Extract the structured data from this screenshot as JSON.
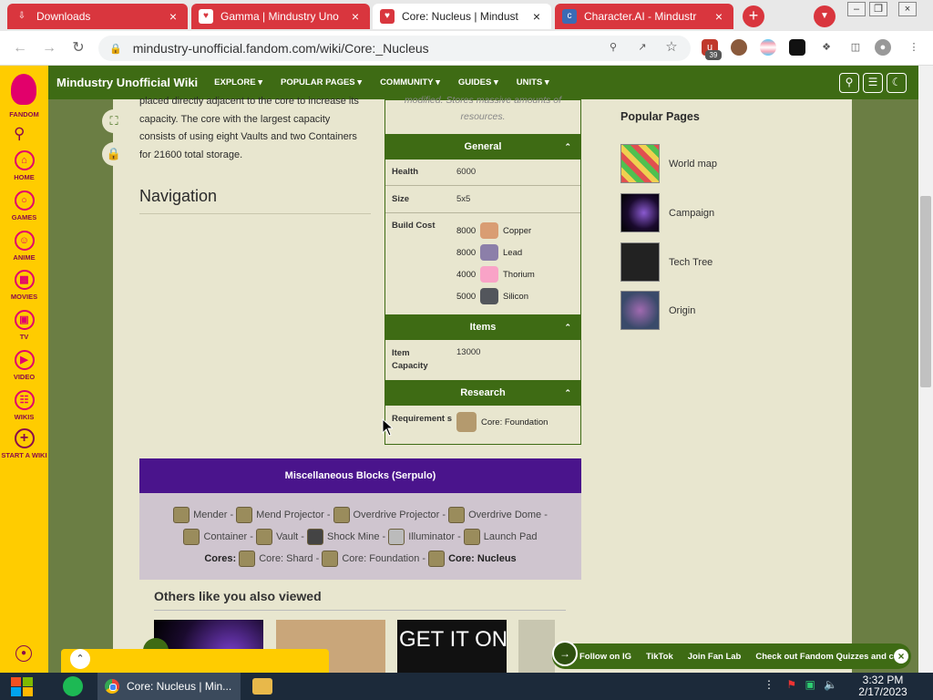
{
  "browser": {
    "tabs": [
      {
        "label": "Downloads",
        "icon": "download-icon",
        "active": false
      },
      {
        "label": "Gamma | Mindustry Uno",
        "icon": "fandom-icon",
        "active": false
      },
      {
        "label": "Core: Nucleus | Mindust",
        "icon": "fandom-icon",
        "active": true
      },
      {
        "label": "Character.AI - Mindustr",
        "icon": "character-ai-icon",
        "active": false
      }
    ],
    "new_tab_label": "+",
    "url": "mindustry-unofficial.fandom.com/wiki/Core:_Nucleus",
    "extension_badge": "39"
  },
  "rail": {
    "fandom": "FANDOM",
    "items": [
      {
        "label": "HOME",
        "icon": "home-icon"
      },
      {
        "label": "GAMES",
        "icon": "games-icon"
      },
      {
        "label": "ANIME",
        "icon": "anime-icon"
      },
      {
        "label": "MOVIES",
        "icon": "movies-icon"
      },
      {
        "label": "TV",
        "icon": "tv-icon"
      },
      {
        "label": "VIDEO",
        "icon": "video-icon"
      },
      {
        "label": "WIKIS",
        "icon": "wikis-icon"
      },
      {
        "label": "START A WIKI",
        "icon": "plus-icon"
      }
    ]
  },
  "wiki_nav": {
    "title": "Mindustry Unofficial Wiki",
    "links": [
      "EXPLORE",
      "POPULAR PAGES",
      "COMMUNITY",
      "GUIDES",
      "UNITS"
    ]
  },
  "article": {
    "intro": "placed directly adjacent to the core to increase its capacity. The core with the largest capacity consists of using eight Vaults and two Containers for 21600 total storage.",
    "navigation_heading": "Navigation"
  },
  "infobox": {
    "quote": "modified. Stores massive amounts of resources.",
    "sections": {
      "general": "General",
      "items": "Items",
      "research": "Research"
    },
    "health_label": "Health",
    "health_value": "6000",
    "size_label": "Size",
    "size_value": "5x5",
    "build_cost_label": "Build Cost",
    "build_cost": [
      {
        "amount": "8000",
        "item": "Copper",
        "color": "#d99d73"
      },
      {
        "amount": "8000",
        "item": "Lead",
        "color": "#8c7fa9"
      },
      {
        "amount": "4000",
        "item": "Thorium",
        "color": "#f9a3c7"
      },
      {
        "amount": "5000",
        "item": "Silicon",
        "color": "#53565c"
      }
    ],
    "item_capacity_label": "Item Capacity",
    "item_capacity_value": "13000",
    "requirement_label": "Requirement s",
    "requirement_value": "Core: Foundation"
  },
  "navbox": {
    "title": "Miscellaneous Blocks (Serpulo)",
    "line1": [
      "Mender",
      "Mend Projector",
      "Overdrive Projector",
      "Overdrive Dome"
    ],
    "line2": [
      "Container",
      "Vault",
      "Shock Mine",
      "Illuminator",
      "Launch Pad"
    ],
    "cores_label": "Cores:",
    "cores": [
      "Core: Shard",
      "Core: Foundation",
      "Core: Nucleus"
    ]
  },
  "others": {
    "heading": "Others like you also viewed",
    "thumb3_text": "GET IT ON"
  },
  "sidebar": {
    "popular_heading": "Popular Pages",
    "items": [
      {
        "label": "World map"
      },
      {
        "label": "Campaign"
      },
      {
        "label": "Tech Tree"
      },
      {
        "label": "Origin"
      }
    ]
  },
  "follow_bar": {
    "links": [
      "Follow on IG",
      "TikTok",
      "Join Fan Lab",
      "Check out Fandom Quizzes and cha"
    ]
  },
  "taskbar": {
    "chrome_window": "Core: Nucleus | Min...",
    "time": "3:32 PM",
    "date": "2/17/2023"
  },
  "colors": {
    "wiki_green": "#3e6b14",
    "fandom_yellow": "#ffcc00",
    "navbox_purple": "#4a148c",
    "chrome_red": "#d9363e"
  }
}
